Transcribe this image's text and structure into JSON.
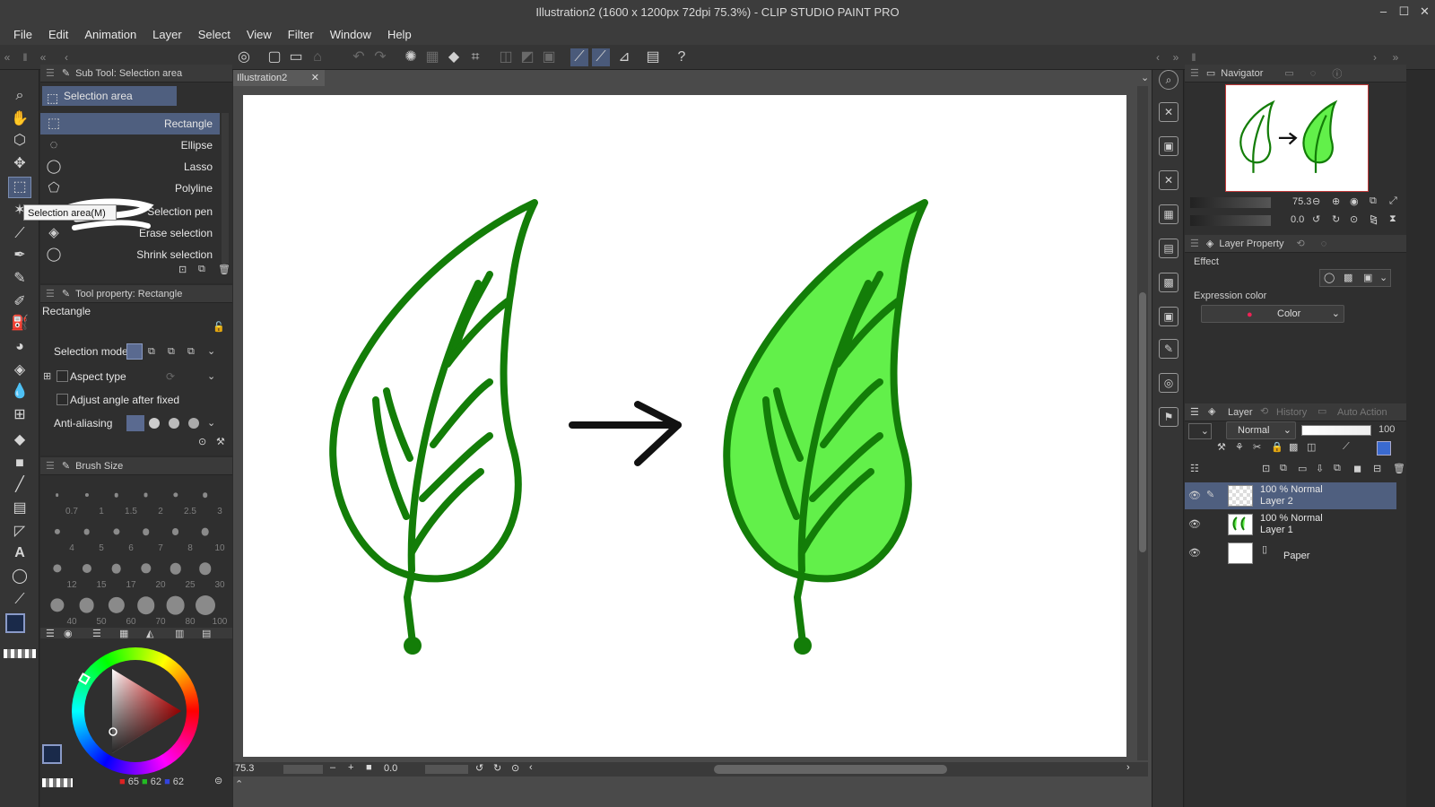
{
  "window": {
    "title": "Illustration2 (1600 x 1200px 72dpi 75.3%) - CLIP STUDIO PAINT PRO",
    "controls": [
      "–",
      "☐",
      "✕"
    ]
  },
  "menu": [
    "File",
    "Edit",
    "Animation",
    "Layer",
    "Select",
    "View",
    "Filter",
    "Window",
    "Help"
  ],
  "sub_tool": {
    "header": "Sub Tool: Selection area",
    "group_tab": "Selection area",
    "items": [
      "Rectangle",
      "Ellipse",
      "Lasso",
      "Polyline",
      "Selection pen",
      "Erase selection",
      "Shrink selection"
    ],
    "selected": "Rectangle"
  },
  "tooltip": "Selection area(M)",
  "tool_property": {
    "header": "Tool property: Rectangle",
    "name": "Rectangle",
    "rows": {
      "selection_mode": "Selection mode",
      "aspect_type": "Aspect type",
      "adjust_angle": "Adjust angle after fixed",
      "anti_aliasing": "Anti-aliasing"
    }
  },
  "brush_size": {
    "header": "Brush Size",
    "sizes": [
      "0.7",
      "1",
      "1.5",
      "2",
      "2.5",
      "3",
      "4",
      "5",
      "6",
      "7",
      "8",
      "10",
      "12",
      "15",
      "17",
      "20",
      "25",
      "30",
      "40",
      "50",
      "60",
      "70",
      "80",
      "100"
    ]
  },
  "color": {
    "r": "65",
    "g": "62",
    "b": "62",
    "r_label": "■",
    "g_label": "■",
    "b_label": "■",
    "main_color": "#1a2a4a",
    "sub_color": "#ffffff"
  },
  "document": {
    "tab": "Illustration2",
    "tab_close": "✕"
  },
  "status": {
    "zoom": "75.3",
    "rotation": "0.0"
  },
  "navigator": {
    "header": "Navigator",
    "zoom": "75.3",
    "rotation": "0.0"
  },
  "layer_property": {
    "header": "Layer Property",
    "effect": "Effect",
    "expression_color": "Expression color",
    "color_value": "Color"
  },
  "layer_panel": {
    "tabs": [
      "Layer",
      "History",
      "Auto Action"
    ],
    "blend_mode": "Normal",
    "opacity": "100",
    "layers": [
      {
        "blend": "100 % Normal",
        "name": "Layer 2",
        "selected": true
      },
      {
        "blend": "100 % Normal",
        "name": "Layer 1",
        "selected": false
      },
      {
        "blend": "",
        "name": "Paper",
        "selected": false
      }
    ]
  },
  "colors": {
    "leaf_stroke": "#137d08",
    "leaf_fill": "#62f04a",
    "accent": "#4f5f7f"
  }
}
